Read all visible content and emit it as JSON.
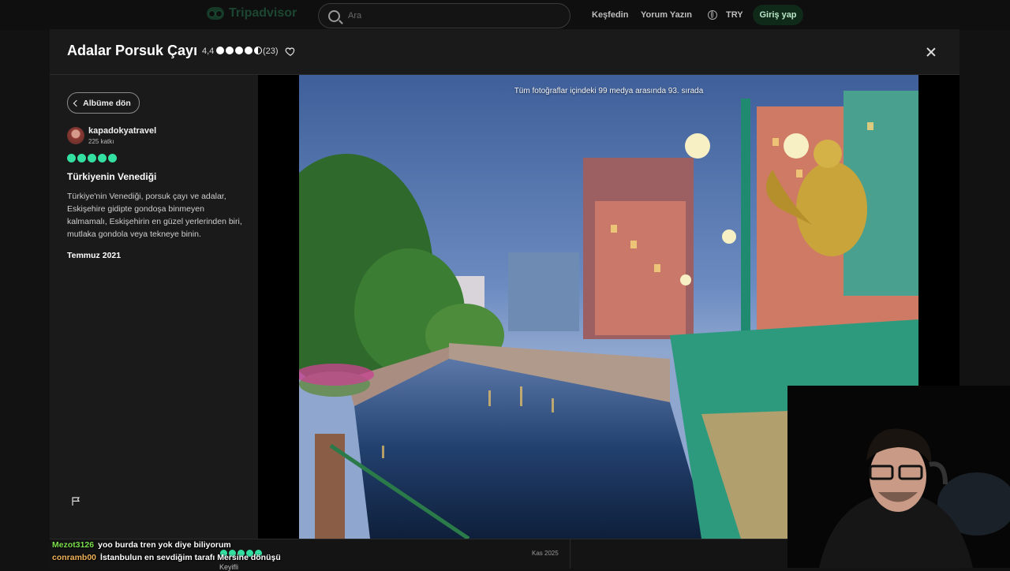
{
  "header": {
    "logo_text": "Tripadvisor",
    "search_placeholder": "Ara",
    "nav": [
      "Keşfedin",
      "Yorum Yazın"
    ],
    "currency": "TRY",
    "login_label": "Giriş yap"
  },
  "modal": {
    "title": "Adalar Porsuk Çayı",
    "rating": "4,4",
    "rating_value": 4.5,
    "review_count": "(23)",
    "colors": {
      "accent": "#34e0a1",
      "background": "#1a1a1a"
    }
  },
  "review": {
    "back_label": "Albüme dön",
    "username": "kapadokyatravel",
    "contributions": "225 katkı",
    "bubbles": 5,
    "title": "Türkiyenin Venediği",
    "body": "Türkiye'nin Venediği, porsuk çayı ve adalar, Eskişehire gidipte gondoşa binmeyen kalmamalı, Eskişehirin en güzel yerlerinden biri, mutlaka gondola veya tekneye binin.",
    "date": "Temmuz 2021"
  },
  "photo": {
    "caption": "Tüm fotoğraflar içindeki 99 medya arasında 93. sırada"
  },
  "bottom_strip": {
    "word": "Keyifli",
    "date": "Kas 2025"
  },
  "chat": [
    {
      "user": "Mezot3126",
      "message": "yoo burda tren yok diye biliyorum"
    },
    {
      "user": "conramb00",
      "message": "İstanbulun en sevdiğim tarafı Mersine dönüşü"
    }
  ]
}
